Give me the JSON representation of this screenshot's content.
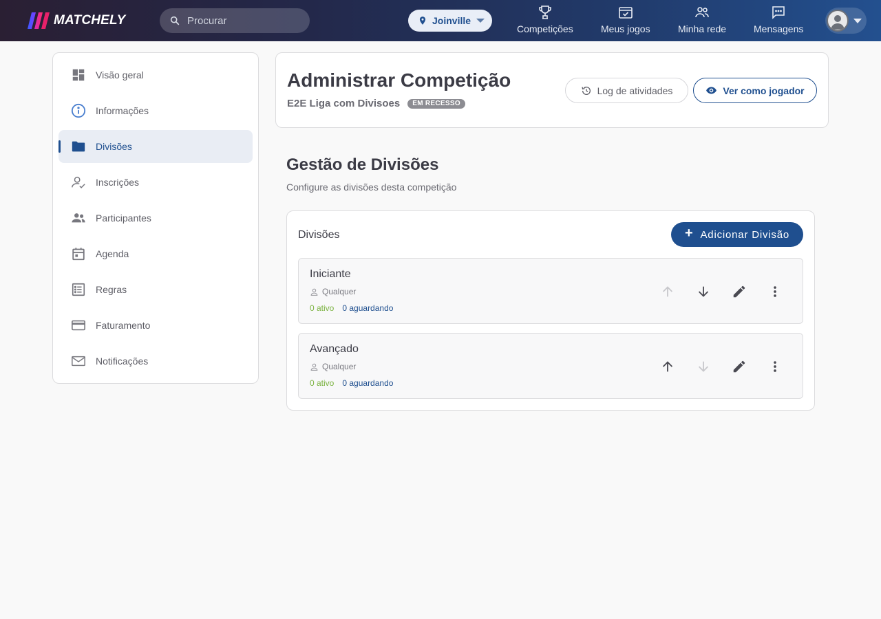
{
  "app": {
    "brand": "MATCHELY",
    "search_placeholder": "Procurar",
    "city": "Joinville",
    "nav": [
      {
        "label": "Competições",
        "icon": "trophy-icon"
      },
      {
        "label": "Meus jogos",
        "icon": "calendar-check-icon"
      },
      {
        "label": "Minha rede",
        "icon": "people-icon"
      },
      {
        "label": "Mensagens",
        "icon": "chat-icon"
      }
    ]
  },
  "sidebar": {
    "items": [
      {
        "label": "Visão geral",
        "icon": "dashboard-icon"
      },
      {
        "label": "Informações",
        "icon": "info-icon"
      },
      {
        "label": "Divisões",
        "icon": "folder-icon",
        "active": true
      },
      {
        "label": "Inscrições",
        "icon": "person-check-icon"
      },
      {
        "label": "Participantes",
        "icon": "group-icon"
      },
      {
        "label": "Agenda",
        "icon": "calendar-icon"
      },
      {
        "label": "Regras",
        "icon": "list-icon"
      },
      {
        "label": "Faturamento",
        "icon": "credit-card-icon"
      },
      {
        "label": "Notificações",
        "icon": "mail-icon"
      }
    ]
  },
  "header": {
    "title": "Administrar Competição",
    "competition_name": "E2E Liga com Divisoes",
    "status": "EM RECESSO",
    "log_button": "Log de atividades",
    "view_button": "Ver como jogador"
  },
  "section": {
    "title": "Gestão de Divisões",
    "subtitle": "Configure as divisões desta competição"
  },
  "divisions_card": {
    "title": "Divisões",
    "add_button": "Adicionar Divisão",
    "items": [
      {
        "name": "Iniciante",
        "level": "Qualquer",
        "active": "0 ativo",
        "waiting": "0 aguardando",
        "move_up_enabled": false,
        "move_down_enabled": true
      },
      {
        "name": "Avançado",
        "level": "Qualquer",
        "active": "0 ativo",
        "waiting": "0 aguardando",
        "move_up_enabled": true,
        "move_down_enabled": false
      }
    ]
  },
  "colors": {
    "primary": "#1f4f8f",
    "active_green": "#7cb342",
    "disabled": "#c8c8cc",
    "icon_gray": "#4a4a52"
  }
}
